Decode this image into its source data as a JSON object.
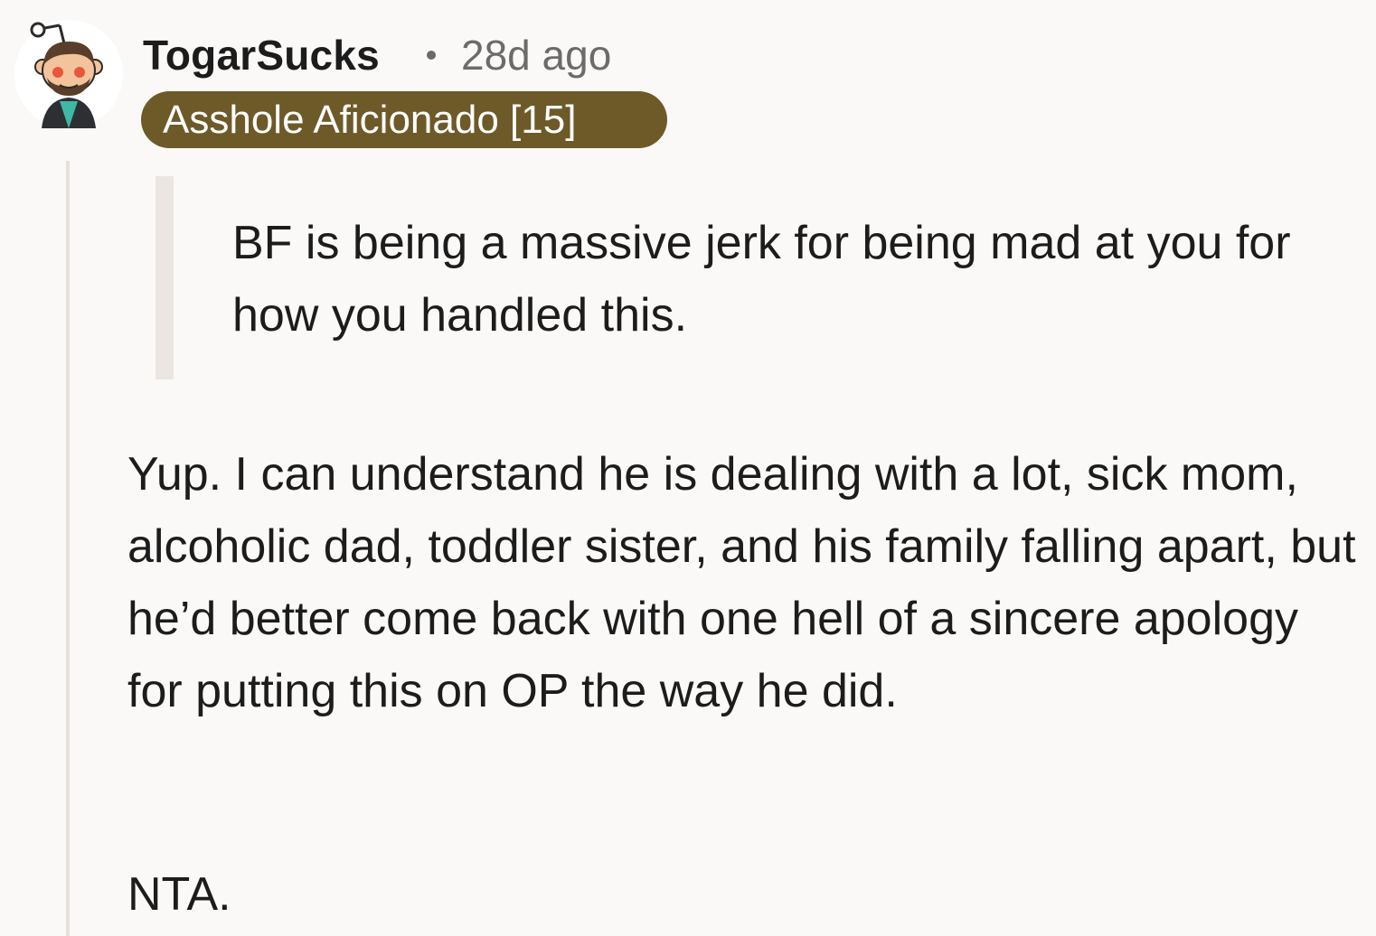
{
  "comment": {
    "author": "TogarSucks",
    "timestamp": "28d ago",
    "flair": "Asshole Aficionado [15]",
    "flair_color": "#6e5a28",
    "quote": "BF is being a massive jerk for being mad at you for how you handled this.",
    "body": "Yup. I can understand he is dealing with a lot, sick mom, alcoholic dad, toddler sister, and his family falling apart, but he’d better come back with one hell of a sincere apology for putting this on OP the way he did.",
    "verdict": "NTA."
  },
  "icons": {
    "avatar": "snoo-avatar-icon"
  }
}
